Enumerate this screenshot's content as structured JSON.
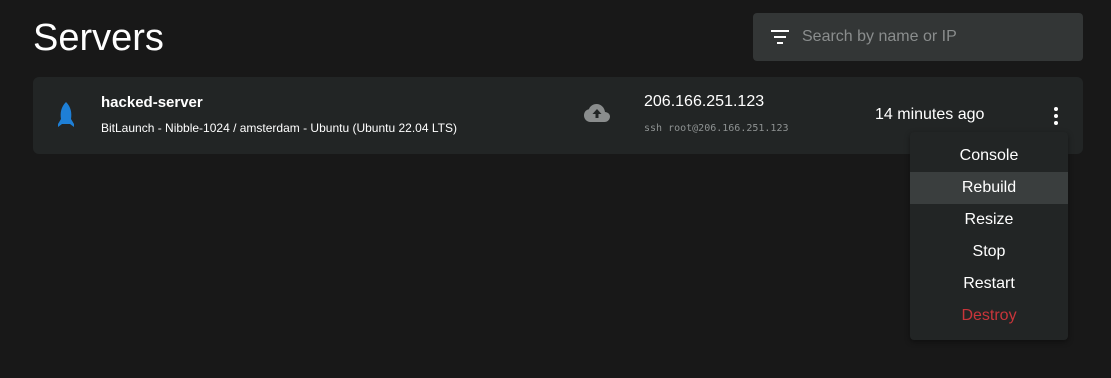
{
  "header": {
    "title": "Servers"
  },
  "search": {
    "placeholder": "Search by name or IP",
    "icon": "filter-icon"
  },
  "server": {
    "name": "hacked-server",
    "description": "BitLaunch - Nibble-1024 / amsterdam - Ubuntu (Ubuntu 22.04 LTS)",
    "ip": "206.166.251.123",
    "ssh": "ssh root@206.166.251.123",
    "created": "14 minutes ago",
    "icon": "rocket-icon",
    "status_icon": "cloud-upload-icon",
    "icon_color": "#1e7fd6"
  },
  "menu": {
    "items": [
      {
        "label": "Console"
      },
      {
        "label": "Rebuild"
      },
      {
        "label": "Resize"
      },
      {
        "label": "Stop"
      },
      {
        "label": "Restart"
      },
      {
        "label": "Destroy"
      }
    ],
    "danger_color": "#c8353a"
  }
}
